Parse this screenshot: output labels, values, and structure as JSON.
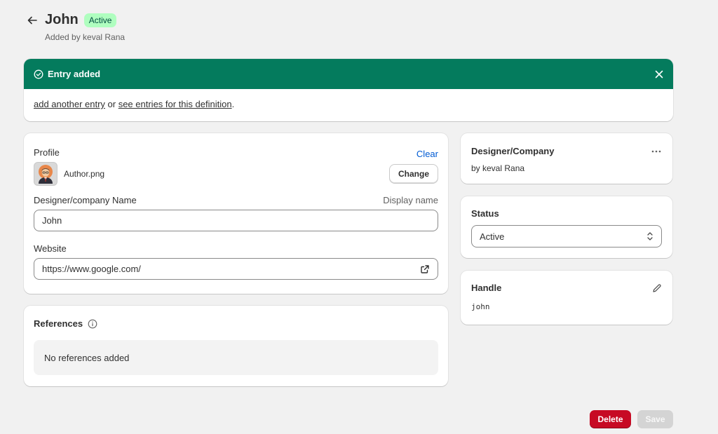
{
  "header": {
    "title": "John",
    "status_badge": "Active",
    "subtitle": "Added by keval Rana"
  },
  "banner": {
    "title": "Entry added",
    "link_add": "add another entry",
    "connector": " or ",
    "link_see": "see entries for this definition",
    "suffix": ".",
    "color": "#047b5d"
  },
  "profile": {
    "label": "Profile",
    "clear_label": "Clear",
    "filename": "Author.png",
    "change_label": "Change"
  },
  "name_field": {
    "label": "Designer/company Name",
    "hint": "Display name",
    "value": "John"
  },
  "website_field": {
    "label": "Website",
    "value": "https://www.google.com/"
  },
  "references": {
    "title": "References",
    "empty_text": "No references added"
  },
  "designer_card": {
    "title": "Designer/Company",
    "subtitle": "by keval Rana"
  },
  "status_card": {
    "title": "Status",
    "selected": "Active"
  },
  "handle_card": {
    "title": "Handle",
    "value": "john"
  },
  "footer": {
    "delete_label": "Delete",
    "save_label": "Save",
    "delete_color": "#c70a24"
  }
}
